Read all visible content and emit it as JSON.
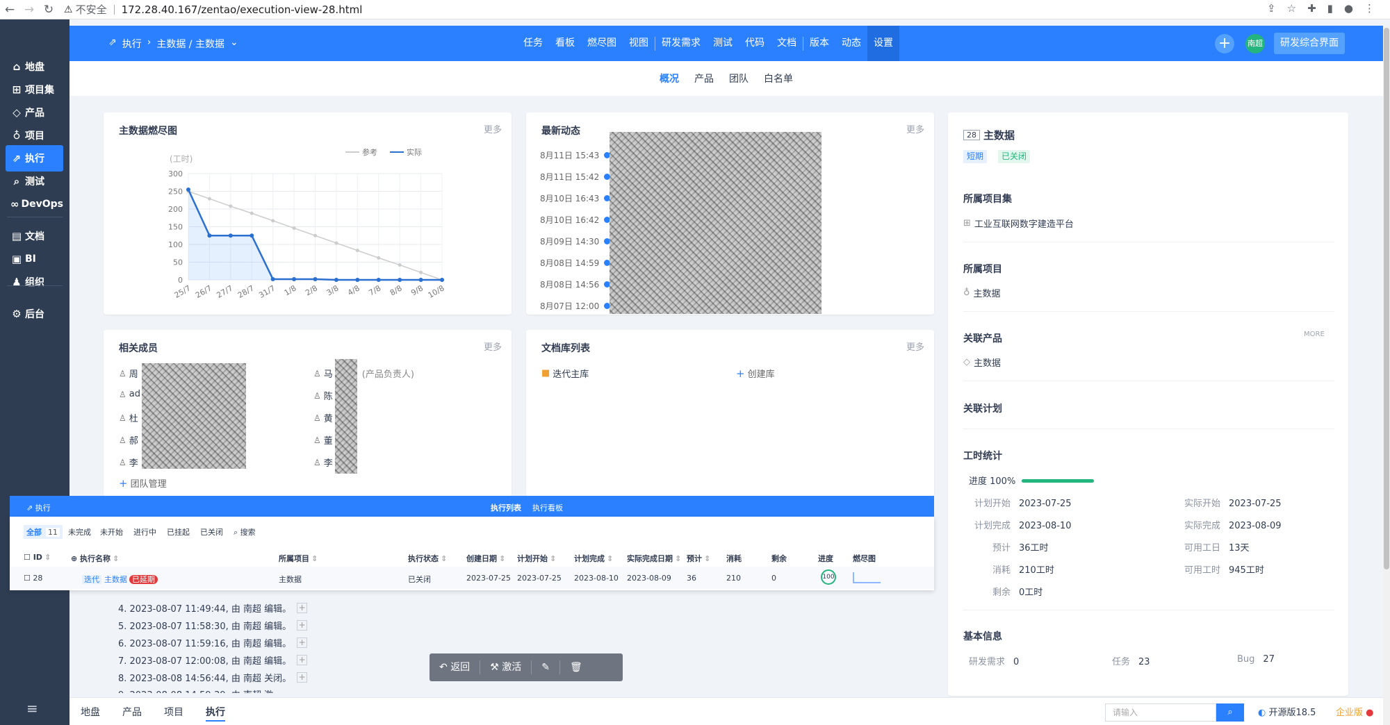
{
  "browser": {
    "insecure_label": "不安全",
    "url": "172.28.40.167/zentao/execution-view-28.html"
  },
  "sidebar": {
    "items": [
      {
        "label": "地盘",
        "icon": "home-icon"
      },
      {
        "label": "项目集",
        "icon": "grid-icon"
      },
      {
        "label": "产品",
        "icon": "cube-icon"
      },
      {
        "label": "项目",
        "icon": "folder-icon"
      },
      {
        "label": "执行",
        "icon": "run-icon"
      },
      {
        "label": "测试",
        "icon": "search-icon"
      },
      {
        "label": "DevOps",
        "icon": "infinity-icon"
      },
      {
        "label": "文档",
        "icon": "doc-icon"
      },
      {
        "label": "BI",
        "icon": "bi-icon"
      },
      {
        "label": "组织",
        "icon": "people-icon"
      },
      {
        "label": "后台",
        "icon": "gear-icon"
      }
    ],
    "active": "执行"
  },
  "topbar": {
    "breadcrumb_root": "执行",
    "breadcrumb_current": "主数据 / 主数据",
    "module_nav": [
      "任务",
      "看板",
      "燃尽图",
      "视图",
      "研发需求",
      "测试",
      "代码",
      "文档",
      "版本",
      "动态",
      "设置"
    ],
    "active_module": "设置",
    "avatar_text": "南超",
    "interface_button": "研发综合界面"
  },
  "subnav": {
    "tabs": [
      "概况",
      "产品",
      "团队",
      "白名单"
    ],
    "active": "概况"
  },
  "burndown": {
    "title": "主数据燃尽图",
    "more": "更多"
  },
  "chart_data": {
    "type": "line",
    "ylabel": "(工时)",
    "ylim": [
      0,
      300
    ],
    "yticks": [
      0,
      50,
      100,
      150,
      200,
      250,
      300
    ],
    "categories": [
      "25/7",
      "26/7",
      "27/7",
      "28/7",
      "31/7",
      "1/8",
      "2/8",
      "3/8",
      "4/8",
      "7/8",
      "8/8",
      "9/8",
      "10/8"
    ],
    "series": [
      {
        "name": "参考",
        "color": "#cccccc",
        "values": [
          250,
          229,
          208,
          188,
          167,
          146,
          125,
          104,
          83,
          62,
          42,
          21,
          0
        ]
      },
      {
        "name": "实际",
        "color": "#2b6fd0",
        "values": [
          255,
          125,
          125,
          125,
          2,
          2,
          2,
          0,
          0,
          0,
          0,
          0,
          0
        ]
      }
    ],
    "legend": "top-right",
    "grid": true
  },
  "dynamics": {
    "title": "最新动态",
    "more": "更多",
    "events": [
      "8月11日 15:43",
      "8月11日 15:42",
      "8月10日 16:43",
      "8月10日 16:42",
      "8月09日 14:30",
      "8月08日 14:59",
      "8月08日 14:56",
      "8月07日 12:00"
    ]
  },
  "members": {
    "title": "相关成员",
    "more": "更多",
    "left": [
      "周",
      "ad",
      "杜",
      "郝",
      "李"
    ],
    "right": [
      "马",
      "陈",
      "黄",
      "董",
      "李"
    ],
    "right_note": "(产品负责人)",
    "manage": "团队管理"
  },
  "doclib": {
    "title": "文档库列表",
    "more": "更多",
    "lib": "迭代主库",
    "create": "创建库"
  },
  "detail": {
    "id": "28",
    "name": "主数据",
    "tag_short": "短期",
    "tag_closed": "已关闭",
    "program_title": "所属项目集",
    "program": "工业互联网数字建造平台",
    "project_title": "所属项目",
    "project": "主数据",
    "product_title": "关联产品",
    "product_more": "MORE",
    "product": "主数据",
    "plan_title": "关联计划",
    "hours_title": "工时统计",
    "progress_label": "进度 100%",
    "progress": 1.0,
    "stats_left": [
      {
        "k": "计划开始",
        "v": "2023-07-25"
      },
      {
        "k": "计划完成",
        "v": "2023-08-10"
      },
      {
        "k": "预计",
        "v": "36工时"
      },
      {
        "k": "消耗",
        "v": "210工时"
      },
      {
        "k": "剩余",
        "v": "0工时"
      }
    ],
    "stats_right": [
      {
        "k": "实际开始",
        "v": "2023-07-25"
      },
      {
        "k": "实际完成",
        "v": "2023-08-09"
      },
      {
        "k": "可用工日",
        "v": "13天"
      },
      {
        "k": "可用工时",
        "v": "945工时"
      }
    ],
    "basic_title": "基本信息",
    "basic": [
      {
        "k": "研发需求",
        "v": "0"
      },
      {
        "k": "任务",
        "v": "23"
      },
      {
        "k": "Bug",
        "v": "27"
      }
    ]
  },
  "overlay": {
    "bar_title": "执行",
    "bar_tab_list": "执行列表",
    "bar_tab_board": "执行看板",
    "filters": [
      "全部",
      "未完成",
      "未开始",
      "进行中",
      "已挂起",
      "已关闭",
      "搜索"
    ],
    "filter_count": "11",
    "columns": [
      "ID",
      "执行名称",
      "所属项目",
      "执行状态",
      "创建日期",
      "计划开始",
      "计划完成",
      "实际完成日期",
      "预计",
      "消耗",
      "剩余",
      "进度",
      "燃尽图"
    ],
    "row": {
      "id": "28",
      "type": "迭代",
      "name": "主数据",
      "badge": "已延期",
      "project": "主数据",
      "status": "已关闭",
      "created": "2023-07-25",
      "plan_start": "2023-07-25",
      "plan_end": "2023-08-10",
      "actual_end": "2023-08-09",
      "estimate": "36",
      "consumed": "210",
      "left": "0",
      "progress": "100"
    }
  },
  "history": [
    "4. 2023-08-07 11:49:44, 由 南超 编辑。",
    "5. 2023-08-07 11:58:30, 由 南超 编辑。",
    "6. 2023-08-07 11:59:16, 由 南超 编辑。",
    "7. 2023-08-07 12:00:08, 由 南超 编辑。",
    "8. 2023-08-08 14:56:44, 由 南超 关闭。"
  ],
  "actions": {
    "back": "返回",
    "activate": "激活"
  },
  "bottom": {
    "tabs": [
      "地盘",
      "产品",
      "项目",
      "执行"
    ],
    "active": "执行",
    "search_placeholder": "请输入",
    "version": "开源版18.5",
    "edition": "企业版"
  }
}
